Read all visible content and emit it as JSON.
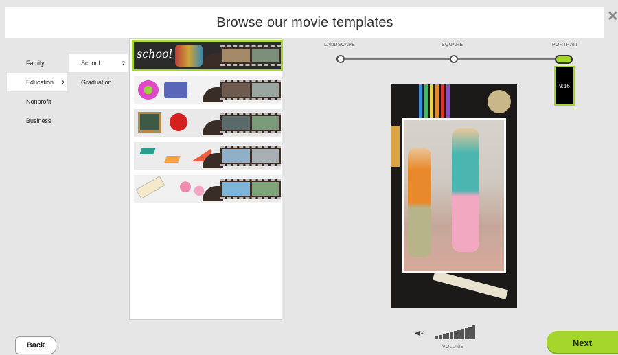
{
  "header": {
    "title": "Browse our movie templates",
    "close_glyph": "✕"
  },
  "categories": [
    {
      "label": "Family",
      "selected": false
    },
    {
      "label": "Education",
      "selected": true,
      "chevron": "›"
    },
    {
      "label": "Nonprofit",
      "selected": false
    },
    {
      "label": "Business",
      "selected": false
    }
  ],
  "subcategories": [
    {
      "label": "School",
      "selected": true,
      "chevron": "›"
    },
    {
      "label": "Graduation",
      "selected": false
    }
  ],
  "templates": [
    {
      "name": "school-template",
      "overlay_text": "school",
      "selected": true,
      "bg": "#2b2b2b"
    },
    {
      "name": "art-supplies-template",
      "selected": false,
      "bg": "#f2f2f2"
    },
    {
      "name": "chalkboard-apple-template",
      "selected": false,
      "bg": "#e9e9e9"
    },
    {
      "name": "paper-arrows-template",
      "selected": false,
      "bg": "#ececec"
    },
    {
      "name": "diploma-blossom-template",
      "selected": false,
      "bg": "#f0f0f0"
    }
  ],
  "aspect": {
    "options": [
      {
        "label": "LANDSCAPE",
        "active": false
      },
      {
        "label": "SQUARE",
        "active": false
      },
      {
        "label": "PORTRAIT",
        "active": true
      }
    ],
    "ratio": "9:16"
  },
  "buttons": {
    "back": "Back",
    "next": "Next"
  },
  "volume": {
    "label": "VOLUME",
    "mute_glyph": "◀×",
    "level": 1.0
  },
  "colors": {
    "accent": "#a4d62c",
    "panel": "#ffffff",
    "background": "#e6e6e6"
  }
}
